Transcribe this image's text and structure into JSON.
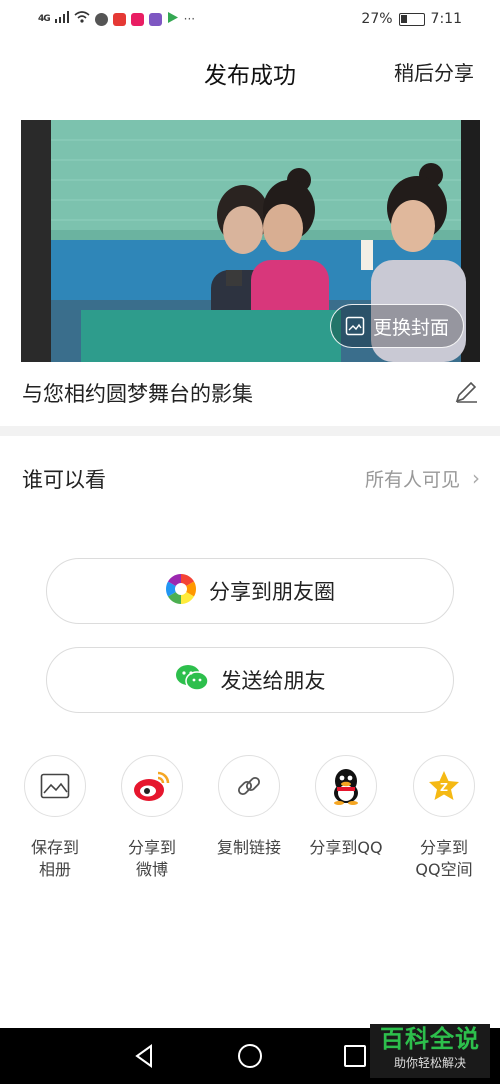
{
  "status_bar": {
    "signal": "4G",
    "battery": "27%",
    "time": "7:11"
  },
  "header": {
    "title": "发布成功",
    "share_later": "稍后分享"
  },
  "cover": {
    "change_cover_label": "更换封面"
  },
  "album": {
    "title": "与您相约圆梦舞台的影集"
  },
  "visibility": {
    "label": "谁可以看",
    "value": "所有人可见",
    "chevron": "›"
  },
  "buttons": {
    "moments": "分享到朋友圈",
    "send_friend": "发送给朋友"
  },
  "share": {
    "items": [
      {
        "label_line1": "保存到",
        "label_line2": "相册",
        "icon": "image-icon"
      },
      {
        "label_line1": "分享到",
        "label_line2": "微博",
        "icon": "weibo-icon"
      },
      {
        "label_line1": "复制链接",
        "label_line2": "",
        "icon": "link-icon"
      },
      {
        "label_line1": "分享到QQ",
        "label_line2": "",
        "icon": "qq-icon"
      },
      {
        "label_line1": "分享到",
        "label_line2": "QQ空间",
        "icon": "qzone-icon"
      }
    ]
  },
  "watermark": {
    "main": "百科全说",
    "sub": "助你轻松解决"
  },
  "colors": {
    "wechat_green": "#2dbf4c",
    "weibo_red": "#e6162d",
    "qzone_yellow": "#f5b914"
  }
}
